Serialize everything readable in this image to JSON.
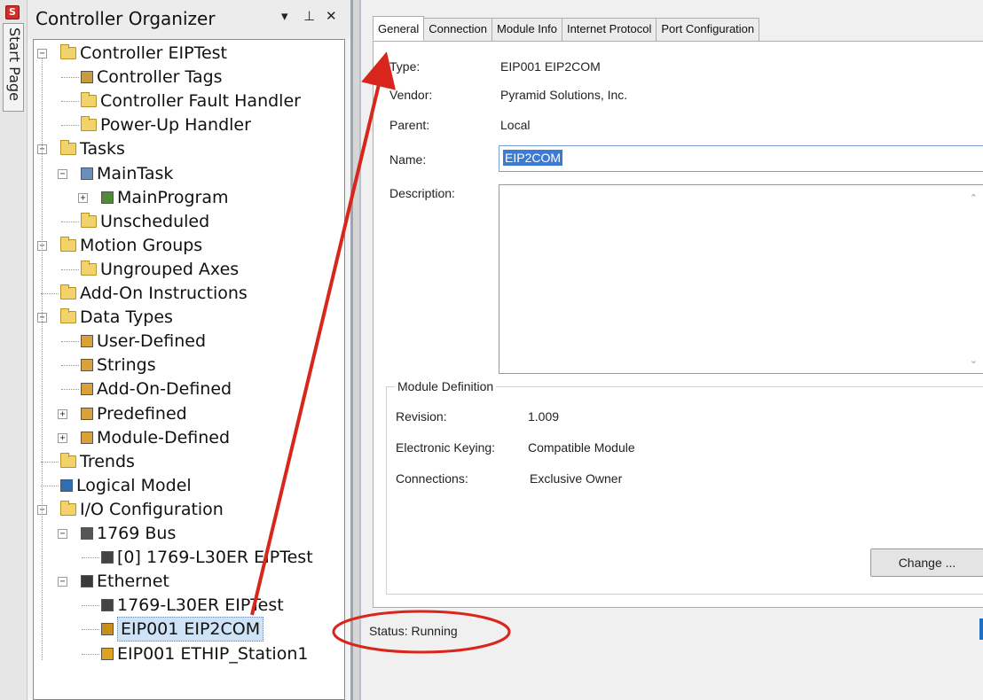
{
  "sidebar_strip": {
    "label": "Start Page"
  },
  "organizer": {
    "title": "Controller Organizer",
    "buttons": {
      "dropdown": "▾",
      "pin": "⊥",
      "close": "✕"
    },
    "tree": [
      {
        "label": "Controller EIPTest",
        "icon": "folder-icon"
      },
      {
        "label": "Controller Tags",
        "icon": "tags-icon"
      },
      {
        "label": "Controller Fault Handler",
        "icon": "folder-icon"
      },
      {
        "label": "Power-Up Handler",
        "icon": "folder-icon"
      },
      {
        "label": "Tasks",
        "icon": "folder-icon"
      },
      {
        "label": "MainTask",
        "icon": "task-icon"
      },
      {
        "label": "MainProgram",
        "icon": "program-icon"
      },
      {
        "label": "Unscheduled",
        "icon": "folder-icon"
      },
      {
        "label": "Motion Groups",
        "icon": "folder-icon"
      },
      {
        "label": "Ungrouped Axes",
        "icon": "folder-icon"
      },
      {
        "label": "Add-On Instructions",
        "icon": "folder-icon"
      },
      {
        "label": "Data Types",
        "icon": "folder-icon"
      },
      {
        "label": "User-Defined",
        "icon": "datatype-icon"
      },
      {
        "label": "Strings",
        "icon": "datatype-icon"
      },
      {
        "label": "Add-On-Defined",
        "icon": "datatype-icon"
      },
      {
        "label": "Predefined",
        "icon": "datatype-icon"
      },
      {
        "label": "Module-Defined",
        "icon": "datatype-icon"
      },
      {
        "label": "Trends",
        "icon": "folder-icon"
      },
      {
        "label": "Logical Model",
        "icon": "logical-model-icon"
      },
      {
        "label": "I/O Configuration",
        "icon": "folder-icon"
      },
      {
        "label": "1769 Bus",
        "icon": "bus-icon"
      },
      {
        "label": "[0] 1769-L30ER EIPTest",
        "icon": "module-icon"
      },
      {
        "label": "Ethernet",
        "icon": "network-icon"
      },
      {
        "label": "1769-L30ER EIPTest",
        "icon": "module-icon"
      },
      {
        "label": "EIP001 EIP2COM",
        "icon": "device-icon"
      },
      {
        "label": "EIP001 ETHIP_Station1",
        "icon": "device-warning-icon"
      }
    ]
  },
  "properties": {
    "tabs": [
      "General",
      "Connection",
      "Module Info",
      "Internet Protocol",
      "Port Configuration"
    ],
    "active_tab": "General",
    "type_label": "Type:",
    "type_value": "EIP001 EIP2COM",
    "vendor_label": "Vendor:",
    "vendor_value": "Pyramid Solutions, Inc.",
    "parent_label": "Parent:",
    "parent_value": "Local",
    "name_label": "Name:",
    "name_value": "EIP2COM",
    "description_label": "Description:",
    "description_value": "",
    "module_definition": {
      "title": "Module Definition",
      "revision_label": "Revision:",
      "revision_value": "1.009",
      "keying_label": "Electronic Keying:",
      "keying_value": "Compatible Module",
      "connections_label": "Connections:",
      "connections_value": "Exclusive Owner",
      "change_button": "Change ..."
    },
    "status_label": "Status:",
    "status_value": "Running"
  },
  "colors": {
    "annotation_red": "#d9261c",
    "selection_blue": "#3b7bd6",
    "folder_yellow": "#f2d36b"
  }
}
